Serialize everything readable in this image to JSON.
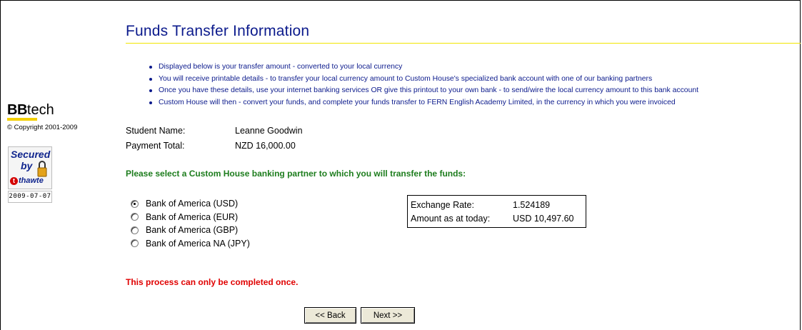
{
  "page": {
    "title": "Funds Transfer Information",
    "bullets": [
      "Displayed below is your transfer amount - converted to your local currency",
      "You will receive printable details - to transfer your local currency amount to Custom House's specialized bank account with one of our banking partners",
      "Once you have these details, use your internet banking services OR give this printout to your own bank - to send/wire the local currency amount to this bank account",
      "Custom House will then - convert your funds, and complete your funds transfer to FERN English Academy Limited, in the currency in which you were invoiced"
    ]
  },
  "sidebar": {
    "logo_bb": "BB",
    "logo_tech": "tech",
    "copyright": "© Copyright 2001-2009",
    "seal_secured": "Secured",
    "seal_by": "by",
    "seal_brand": "thawte",
    "seal_date": "2009-07-07"
  },
  "student": {
    "name_label": "Student Name:",
    "name_value": "Leanne Goodwin",
    "total_label": "Payment Total:",
    "total_value": "NZD 16,000.00"
  },
  "prompt": "Please select a Custom House banking partner to which you will transfer the funds:",
  "bank_options": [
    {
      "label": "Bank of America (USD)",
      "checked": true
    },
    {
      "label": "Bank of America (EUR)",
      "checked": false
    },
    {
      "label": "Bank of America (GBP)",
      "checked": false
    },
    {
      "label": "Bank of America NA (JPY)",
      "checked": false
    }
  ],
  "rate": {
    "exchange_label": "Exchange Rate:",
    "exchange_value": "1.524189",
    "amount_label": "Amount as at today:",
    "amount_value": "USD 10,497.60"
  },
  "warning": "This process can only be completed once.",
  "buttons": {
    "back": "<< Back",
    "next": "Next >>"
  },
  "colors": {
    "title": "#0b1a8c",
    "prompt": "#1d7d1d",
    "warning": "#e00000",
    "rule": "#f2e600"
  }
}
